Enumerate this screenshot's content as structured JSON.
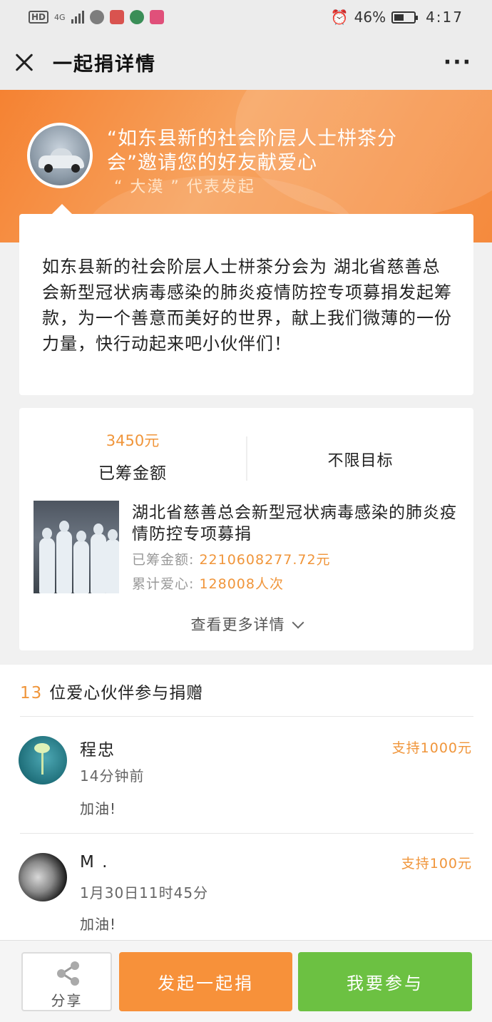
{
  "status_bar": {
    "hd": "HD",
    "network": "4G",
    "battery": "46%",
    "time": "4:17"
  },
  "nav": {
    "title": "一起捐详情",
    "more": "···"
  },
  "hero": {
    "title": "“如东县新的社会阶层人士栟茶分会”邀请您的好友献爱心",
    "subtitle": "“ 大漠 ” 代表发起"
  },
  "description": "如东县新的社会阶层人士栟茶分会为 湖北省慈善总会新型冠状病毒感染的肺炎疫情防控专项募捐发起筹款，为一个善意而美好的世界，献上我们微薄的一份力量，快行动起来吧小伙伴们！",
  "stats": {
    "raised_amount": "3450元",
    "raised_label": "已筹金额",
    "target": "不限目标"
  },
  "project": {
    "title": "湖北省慈善总会新型冠状病毒感染的肺炎疫情防控专项募捐",
    "raised_label": "已筹金额:",
    "raised_value": "2210608277.72元",
    "hearts_label": "累计爱心:",
    "hearts_value": "128008人次",
    "more_link": "查看更多详情"
  },
  "donors": {
    "count": "13",
    "header_text": "位爱心伙伴参与捐赠",
    "list": [
      {
        "name": "程忠",
        "amount": "支持1000元",
        "time": "14分钟前",
        "message": "加油!"
      },
      {
        "name": "M .",
        "amount": "支持100元",
        "time": "1月30日11时45分",
        "message": "加油!"
      }
    ]
  },
  "bottom": {
    "share": "分享",
    "initiate": "发起一起捐",
    "join": "我要参与"
  },
  "colors": {
    "orange": "#f7913a",
    "green": "#6cc142",
    "accent_text": "#f0953a"
  }
}
